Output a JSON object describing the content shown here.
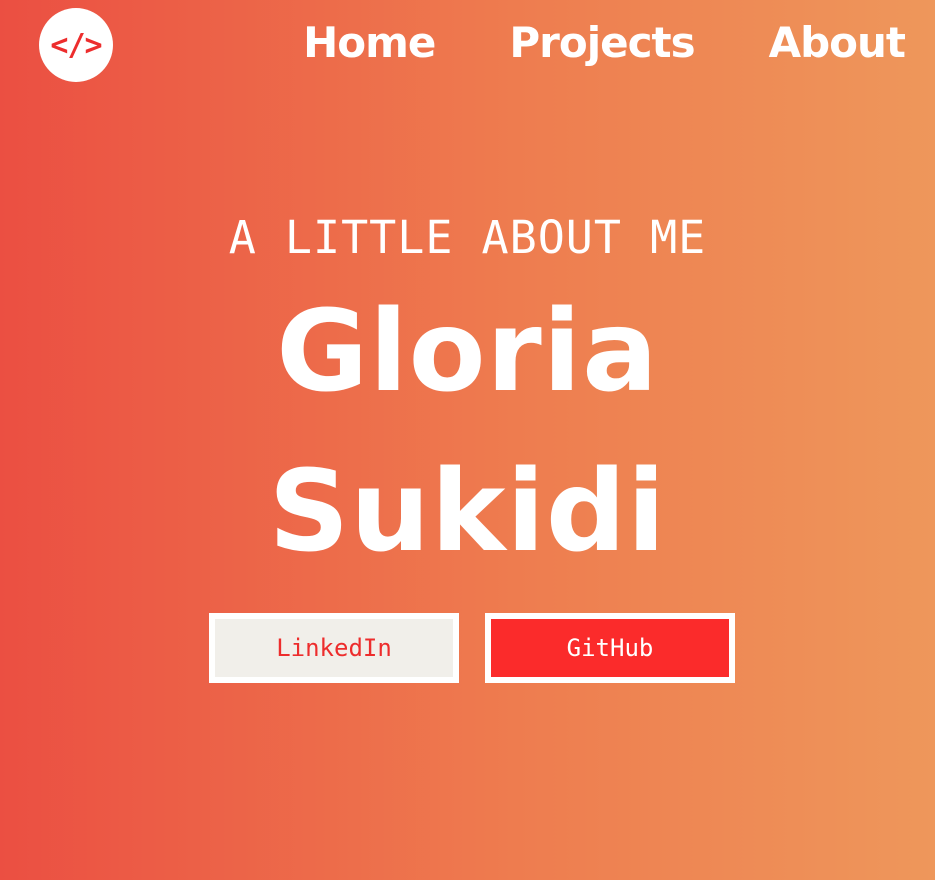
{
  "logo": {
    "icon": "code-brackets-icon",
    "text": "</>"
  },
  "nav": {
    "home": "Home",
    "projects": "Projects",
    "about": "About"
  },
  "hero": {
    "kicker": "A LITTLE ABOUT ME",
    "first_name": "Gloria",
    "last_name": "Sukidi"
  },
  "buttons": {
    "linkedin": "LinkedIn",
    "github": "GitHub"
  },
  "colors": {
    "gradient_start": "#eb4f42",
    "gradient_end": "#ee975b",
    "accent_red": "#ed2d2d",
    "github_button": "#fb2b2b",
    "linkedin_button": "#f1efea"
  }
}
